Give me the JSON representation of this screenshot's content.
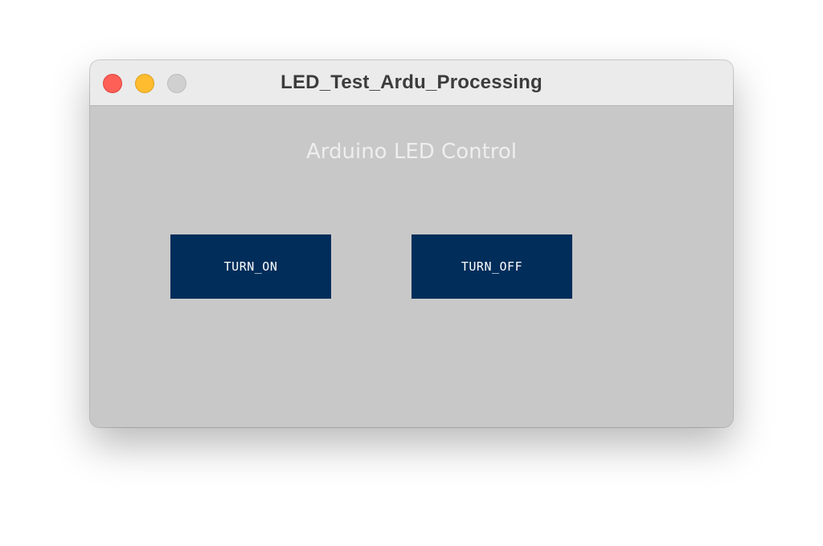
{
  "window": {
    "title": "LED_Test_Ardu_Processing"
  },
  "content": {
    "heading": "Arduino LED Control",
    "buttons": {
      "turn_on_label": "TURN_ON",
      "turn_off_label": "TURN_OFF"
    }
  },
  "colors": {
    "button_background": "#002d5a",
    "canvas_background": "#c8c8c8",
    "heading_text": "#eeeeee"
  },
  "icons": {
    "close": "close-icon",
    "minimize": "minimize-icon",
    "zoom": "zoom-icon"
  }
}
